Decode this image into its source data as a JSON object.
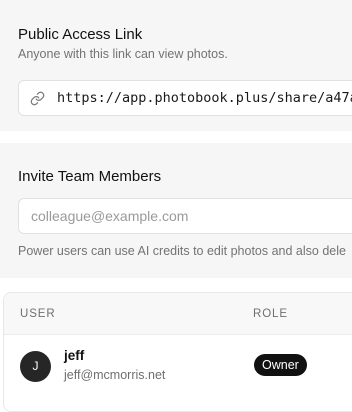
{
  "public_link": {
    "title": "Public Access Link",
    "subtitle": "Anyone with this link can view photos.",
    "url": "https://app.photobook.plus/share/a47a",
    "icon": "link-icon"
  },
  "invite": {
    "title": "Invite Team Members",
    "placeholder": "colleague@example.com",
    "hint": "Power users can use AI credits to edit photos and also dele"
  },
  "members_table": {
    "headers": {
      "user": "USER",
      "role": "ROLE"
    },
    "rows": [
      {
        "initial": "J",
        "name": "jeff",
        "email": "jeff@mcmorris.net",
        "role": "Owner"
      }
    ]
  },
  "colors": {
    "panel_bg": "#f6f6f6",
    "badge_bg": "#111111",
    "muted_text": "#737373"
  }
}
